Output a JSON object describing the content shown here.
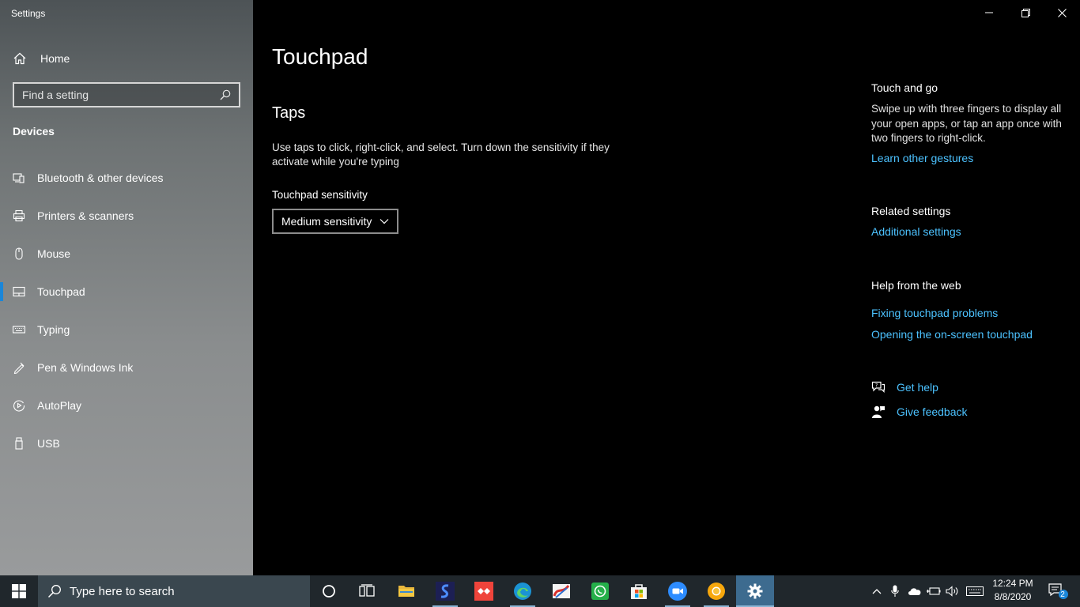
{
  "window": {
    "title": "Settings"
  },
  "sidebar": {
    "home_label": "Home",
    "search_placeholder": "Find a setting",
    "section_label": "Devices",
    "items": [
      {
        "label": "Bluetooth & other devices",
        "icon": "bluetooth-devices-icon"
      },
      {
        "label": "Printers & scanners",
        "icon": "printer-icon"
      },
      {
        "label": "Mouse",
        "icon": "mouse-icon"
      },
      {
        "label": "Touchpad",
        "icon": "touchpad-icon",
        "active": true
      },
      {
        "label": "Typing",
        "icon": "keyboard-icon"
      },
      {
        "label": "Pen & Windows Ink",
        "icon": "pen-icon"
      },
      {
        "label": "AutoPlay",
        "icon": "autoplay-icon"
      },
      {
        "label": "USB",
        "icon": "usb-icon"
      }
    ]
  },
  "main": {
    "title": "Touchpad",
    "section_title": "Taps",
    "description": "Use taps to click, right-click, and select. Turn down the sensitivity if they activate while you're typing",
    "sensitivity_label": "Touchpad sensitivity",
    "sensitivity_value": "Medium sensitivity"
  },
  "right": {
    "touch_heading": "Touch and go",
    "touch_text": "Swipe up with three fingers to display all your open apps, or tap an app once with two fingers to right-click.",
    "touch_link": "Learn other gestures",
    "related_heading": "Related settings",
    "related_link": "Additional settings",
    "web_heading": "Help from the web",
    "web_links": [
      "Fixing touchpad problems",
      "Opening the on-screen touchpad"
    ],
    "get_help": "Get help",
    "give_feedback": "Give feedback"
  },
  "taskbar": {
    "search_placeholder": "Type here to search",
    "apps": [
      "cortana",
      "task-view",
      "file-explorer",
      "slack",
      "anydesk",
      "edge",
      "paint",
      "whatsapp",
      "store",
      "zoom",
      "chrome-canary",
      "settings"
    ],
    "time": "12:24 PM",
    "date": "8/8/2020",
    "notification_count": "2"
  },
  "colors": {
    "accent": "#1a86d9",
    "link": "#4cc2ff",
    "taskbar": "#20272c"
  }
}
